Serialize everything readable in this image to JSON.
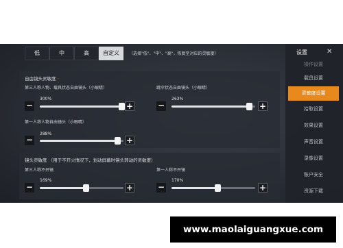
{
  "presets": {
    "items": [
      "低",
      "中",
      "高",
      "自定义"
    ],
    "active_index": 3,
    "note": "（选择\"低\"、\"中\"、\"高\"，恢复至对应的灵敏度）"
  },
  "free_look": {
    "title": "自由镜头灵敏度",
    "marker": "·",
    "sliders": [
      {
        "label": "第三人称人物、载具状态自由镜头（小眼睛）",
        "value": "300%",
        "fraction": 0.93
      },
      {
        "label": "跳伞状态自由镜头（小眼睛）",
        "value": "263%",
        "fraction": 0.93
      },
      {
        "label": "第一人称人物自由镜头（小眼睛）",
        "value": "288%",
        "fraction": 0.93
      }
    ]
  },
  "camera": {
    "title": "镜头灵敏度 （用于不开火情况下，划动屏幕时镜头转动的灵敏度）",
    "sliders": [
      {
        "label": "第三人称不开镜",
        "value": "169%",
        "fraction": 0.55
      },
      {
        "label": "第一人称不开镜",
        "value": "170%",
        "fraction": 0.55
      }
    ]
  },
  "buttons": {
    "minus": "−",
    "plus": "+"
  },
  "menu": {
    "title": "设置",
    "close": "✕",
    "items": [
      "操作设置",
      "载具设置",
      "灵敏度设置",
      "拾取设置",
      "效果设置",
      "声音设置",
      "录像设置",
      "账户安全",
      "资源下载"
    ],
    "active_index": 2
  },
  "banner": {
    "text": "www.maolaiguangxue.com"
  }
}
